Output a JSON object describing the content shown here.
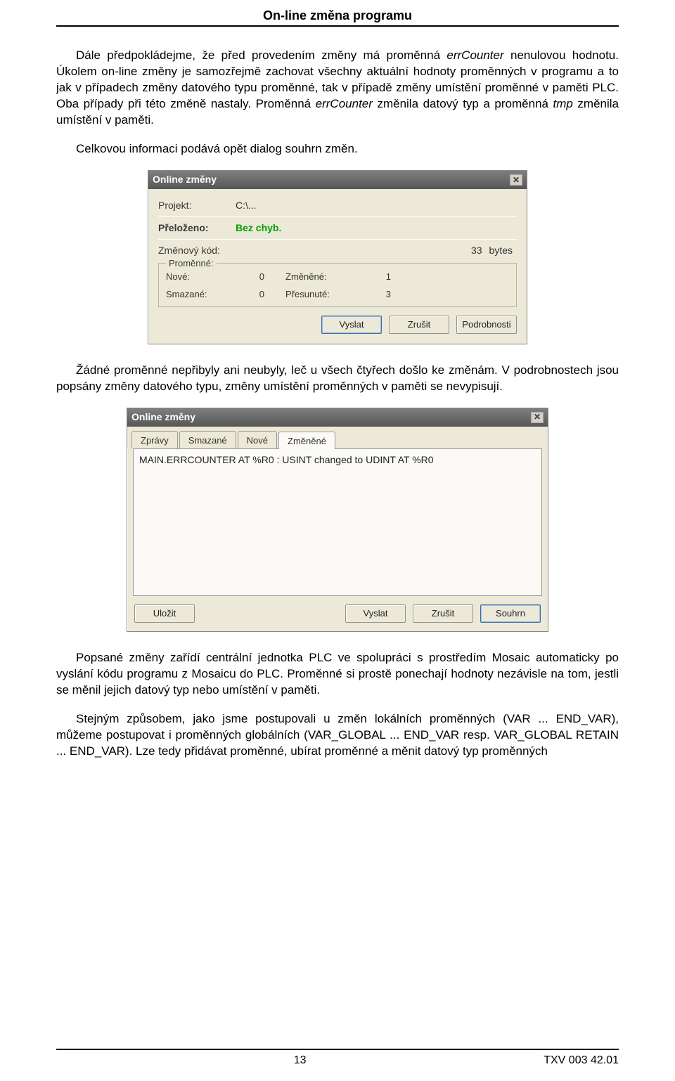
{
  "header": {
    "title": "On-line změna programu"
  },
  "para1a": "Dále předpokládejme, že před provedením změny má proměnná ",
  "para1_var": "errCounter",
  "para1b": " nenulovou hodnotu. Úkolem on-line změny je samozřejmě zachovat všechny aktuální hodnoty proměnných v programu a to jak v případech změny datového typu proměnné, tak v případě změny umístění proměnné v paměti PLC. Oba případy při této změně nastaly. Proměnná ",
  "para1c": " změnila datový typ a proměnná ",
  "para1_tmp": "tmp",
  "para1d": " změnila umístění v paměti.",
  "para2": "Celkovou informaci podává opět dialog souhrn změn.",
  "dialog1": {
    "title": "Online změny",
    "projekt_label": "Projekt:",
    "projekt_value": "C:\\...",
    "prelozeno_label": "Přeloženo:",
    "prelozeno_value": "Bez chyb.",
    "zmenovy_label": "Změnový kód:",
    "zmenovy_value": "33",
    "zmenovy_unit": "bytes",
    "group_legend": "Proměnné:",
    "nove_label": "Nové:",
    "nove_value": "0",
    "zmenene_label": "Změněné:",
    "zmenene_value": "1",
    "smazane_label": "Smazané:",
    "smazane_value": "0",
    "presunute_label": "Přesunuté:",
    "presunute_value": "3",
    "btn_vyslat": "Vyslat",
    "btn_zrusit": "Zrušit",
    "btn_podrobnosti": "Podrobnosti"
  },
  "para3": "Žádné proměnné nepřibyly ani neubyly, leč u všech čtyřech došlo ke změnám. V podrobnostech jsou popsány změny datového typu, změny umístění proměnných v paměti se nevypisují.",
  "dialog2": {
    "title": "Online změny",
    "tabs": {
      "zpravy": "Zprávy",
      "smazane": "Smazané",
      "nove": "Nové",
      "zmenene": "Změněné"
    },
    "content": "MAIN.ERRCOUNTER AT %R0 : USINT changed to UDINT AT %R0",
    "btn_ulozit": "Uložit",
    "btn_vyslat": "Vyslat",
    "btn_zrusit": "Zrušit",
    "btn_souhrn": "Souhrn"
  },
  "para4": "Popsané změny zařídí centrální jednotka PLC ve spolupráci s prostředím Mosaic automaticky po vyslání kódu programu z Mosaicu do PLC. Proměnné si prostě ponechají hodnoty nezávisle na tom, jestli se měnil jejich datový typ nebo umístění v paměti.",
  "para5": "Stejným způsobem, jako jsme postupovali u změn lokálních proměnných (VAR ... END_VAR), můžeme postupovat i proměnných globálních (VAR_GLOBAL ... END_VAR resp. VAR_GLOBAL RETAIN ... END_VAR). Lze tedy přidávat proměnné, ubírat proměnné a měnit datový typ proměnných",
  "footer": {
    "page": "13",
    "docid": "TXV 003 42.01"
  }
}
